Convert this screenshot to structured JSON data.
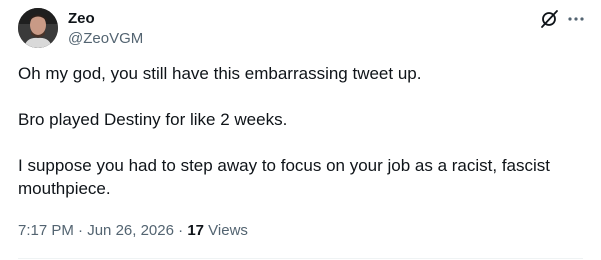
{
  "author": {
    "name": "Zeo",
    "handle": "@ZeoVGM"
  },
  "icons": {
    "header_action": "grok-icon",
    "menu": "more-icon"
  },
  "tweet": {
    "paragraphs": [
      "Oh my god, you still have this embarrassing tweet up.",
      "Bro played Destiny for like 2 weeks.",
      "I suppose you had to step away to focus on your job as a racist, fascist mouthpiece."
    ],
    "time": "7:17 PM",
    "separator": "·",
    "date": "Jun 26, 2026",
    "views_count": "17",
    "views_label": "Views"
  },
  "colors": {
    "text_primary": "#0f1419",
    "text_secondary": "#536471",
    "divider": "#eff3f4"
  }
}
